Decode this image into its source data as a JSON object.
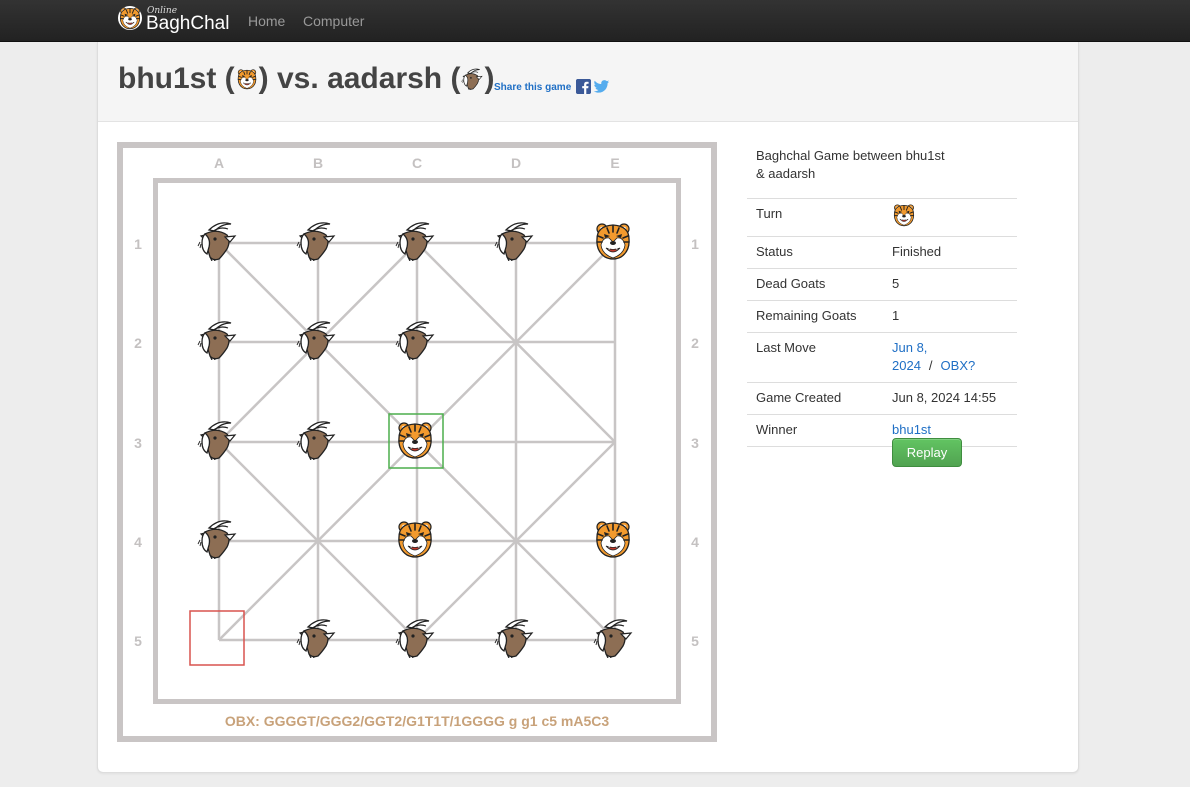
{
  "nav": {
    "brand_small": "Online",
    "brand_name": "BaghChal",
    "links": [
      "Home",
      "Computer"
    ]
  },
  "header": {
    "player1": "bhu1st",
    "vs": "vs.",
    "player2": "aadarsh",
    "share_label": "Share this game"
  },
  "board": {
    "columns": [
      "A",
      "B",
      "C",
      "D",
      "E"
    ],
    "rows": [
      "1",
      "2",
      "3",
      "4",
      "5"
    ],
    "position": [
      [
        "goat",
        "goat",
        "goat",
        "goat",
        "tiger"
      ],
      [
        "goat",
        "goat",
        "goat",
        "",
        ""
      ],
      [
        "goat",
        "goat",
        "tiger",
        "",
        ""
      ],
      [
        "goat",
        "",
        "tiger",
        "",
        "tiger"
      ],
      [
        "",
        "goat",
        "goat",
        "goat",
        "goat"
      ]
    ],
    "last_move_from": "A5",
    "last_move_to": "C3",
    "obx": "OBX: GGGGT/GGG2/GGT2/G1T1T/1GGGG g g1 c5 mA5C3",
    "colors": {
      "frame": "#c9c5c5",
      "line": "#c8c5c5",
      "label": "#c4c1c1",
      "from_box": "#d9534f",
      "to_box": "#4cae4c",
      "obx_text": "#c8a27a"
    }
  },
  "info": {
    "title": "Baghchal Game between bhu1st & aadarsh",
    "turn_label": "Turn",
    "turn_icon": "tiger-icon",
    "status_label": "Status",
    "status_value": "Finished",
    "dead_goats_label": "Dead Goats",
    "dead_goats_value": "5",
    "remaining_goats_label": "Remaining Goats",
    "remaining_goats_value": "1",
    "last_move_label": "Last Move",
    "last_move_date_line1": "Jun 8,",
    "last_move_date_line2": "2024",
    "last_move_separator": "/",
    "obx_link": "OBX?",
    "created_label": "Game Created",
    "created_value": "Jun 8, 2024 14:55",
    "winner_label": "Winner",
    "winner_value": "bhu1st",
    "replay_label": "Replay"
  }
}
